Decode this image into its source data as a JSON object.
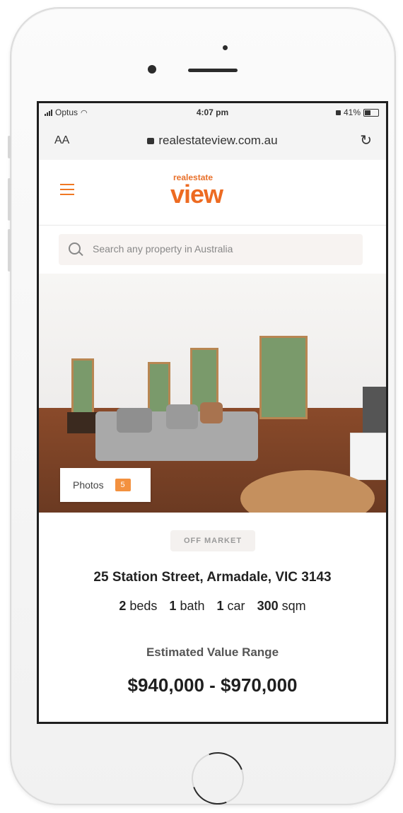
{
  "status_bar": {
    "carrier": "Optus",
    "time": "4:07 pm",
    "battery": "41%"
  },
  "browser": {
    "text_size_label": "AA",
    "url": "realestateview.com.au"
  },
  "header": {
    "logo_small": "realestate",
    "logo_big": "view"
  },
  "search": {
    "placeholder": "Search any property in Australia"
  },
  "gallery": {
    "photos_label": "Photos",
    "photos_count": "5"
  },
  "property": {
    "status_badge": "OFF MARKET",
    "address": "25 Station Street, Armadale, VIC 3143",
    "beds_value": "2",
    "beds_unit": "beds",
    "bath_value": "1",
    "bath_unit": "bath",
    "car_value": "1",
    "car_unit": "car",
    "area_value": "300",
    "area_unit": "sqm",
    "estimate_label": "Estimated Value Range",
    "estimate_value": "$940,000 - $970,000"
  },
  "colors": {
    "brand": "#ed6b22",
    "badge": "#f3913f"
  }
}
